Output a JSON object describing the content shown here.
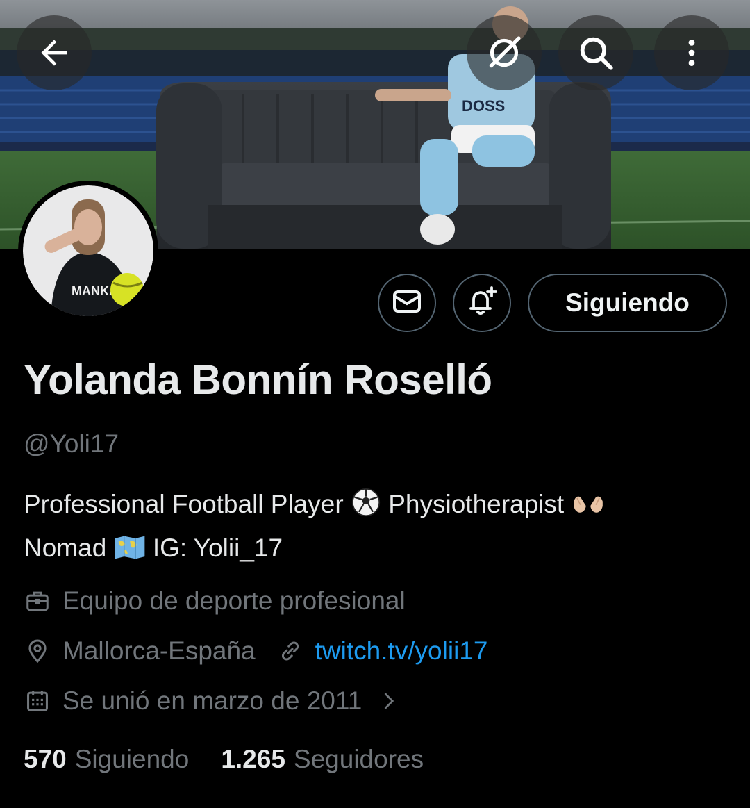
{
  "header": {
    "back_icon": "arrow-left-icon",
    "grok_icon": "grok-icon",
    "search_icon": "search-icon",
    "more_icon": "more-vertical-icon"
  },
  "profile": {
    "display_name": "Yolanda Bonnín Roselló",
    "handle": "@Yoli17",
    "bio_line1_a": "Professional Football Player",
    "bio_line1_b": "Physiotherapist",
    "bio_line2_a": "Nomad",
    "bio_line2_b": "IG: Yolii_17",
    "category": "Equipo de deporte profesional",
    "location": "Mallorca-España",
    "website": "twitch.tv/yolii17",
    "joined": "Se unió en marzo de 2011"
  },
  "actions": {
    "follow_label": "Siguiendo",
    "message_icon": "mail-icon",
    "notify_icon": "bell-plus-icon"
  },
  "stats": {
    "following_count": "570",
    "following_label": "Siguiendo",
    "followers_count": "1.265",
    "followers_label": "Seguidores"
  },
  "colors": {
    "background": "#000000",
    "text_primary": "#e7e9ea",
    "text_secondary": "#71767b",
    "link": "#1d9bf0",
    "border": "#536471"
  }
}
